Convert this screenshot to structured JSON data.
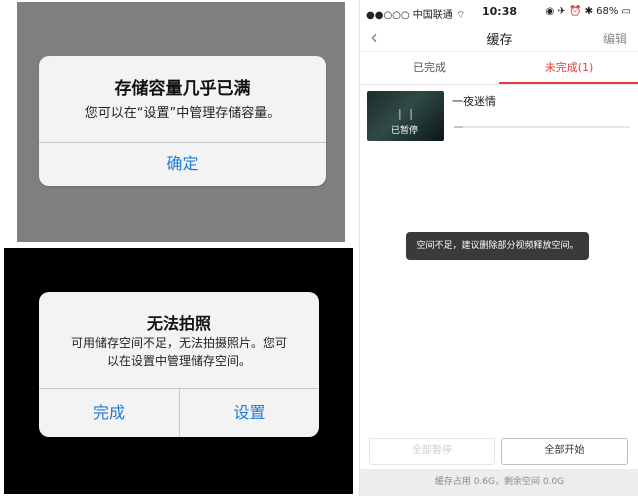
{
  "left_top": {
    "alert": {
      "title": "存储容量几乎已满",
      "message": "您可以在“设置”中管理存储容量。",
      "ok_label": "确定"
    }
  },
  "left_bottom": {
    "alert": {
      "title": "无法拍照",
      "message_line1": "可用储存空间不足，无法拍摄照片。您可",
      "message_line2": "以在设置中管理储存空间。",
      "done_label": "完成",
      "settings_label": "设置"
    }
  },
  "phone": {
    "status_bar": {
      "carrier": "●●○○○ 中国联通 ⌔",
      "time": "10:38",
      "battery": "◉ ✈ ⏰ ✱ 68% ▭"
    },
    "navbar": {
      "back_icon": "chevron-left-icon",
      "title": "缓存",
      "edit_label": "编辑"
    },
    "tabs": {
      "done_label": "已完成",
      "undone_label": "未完成(1)"
    },
    "item": {
      "title": "一夜迷情",
      "thumb_status": "已暂停",
      "progress": 0.05
    },
    "toast": "空间不足，建议删除部分视频释放空间。",
    "buttons": {
      "pause_all": "全部暂停",
      "start_all": "全部开始"
    },
    "footer": "缓存占用 0.6G，剩余空间 0.0G"
  },
  "colors": {
    "accent_red": "#e63a3a",
    "ios_blue": "#1e7bd6"
  }
}
